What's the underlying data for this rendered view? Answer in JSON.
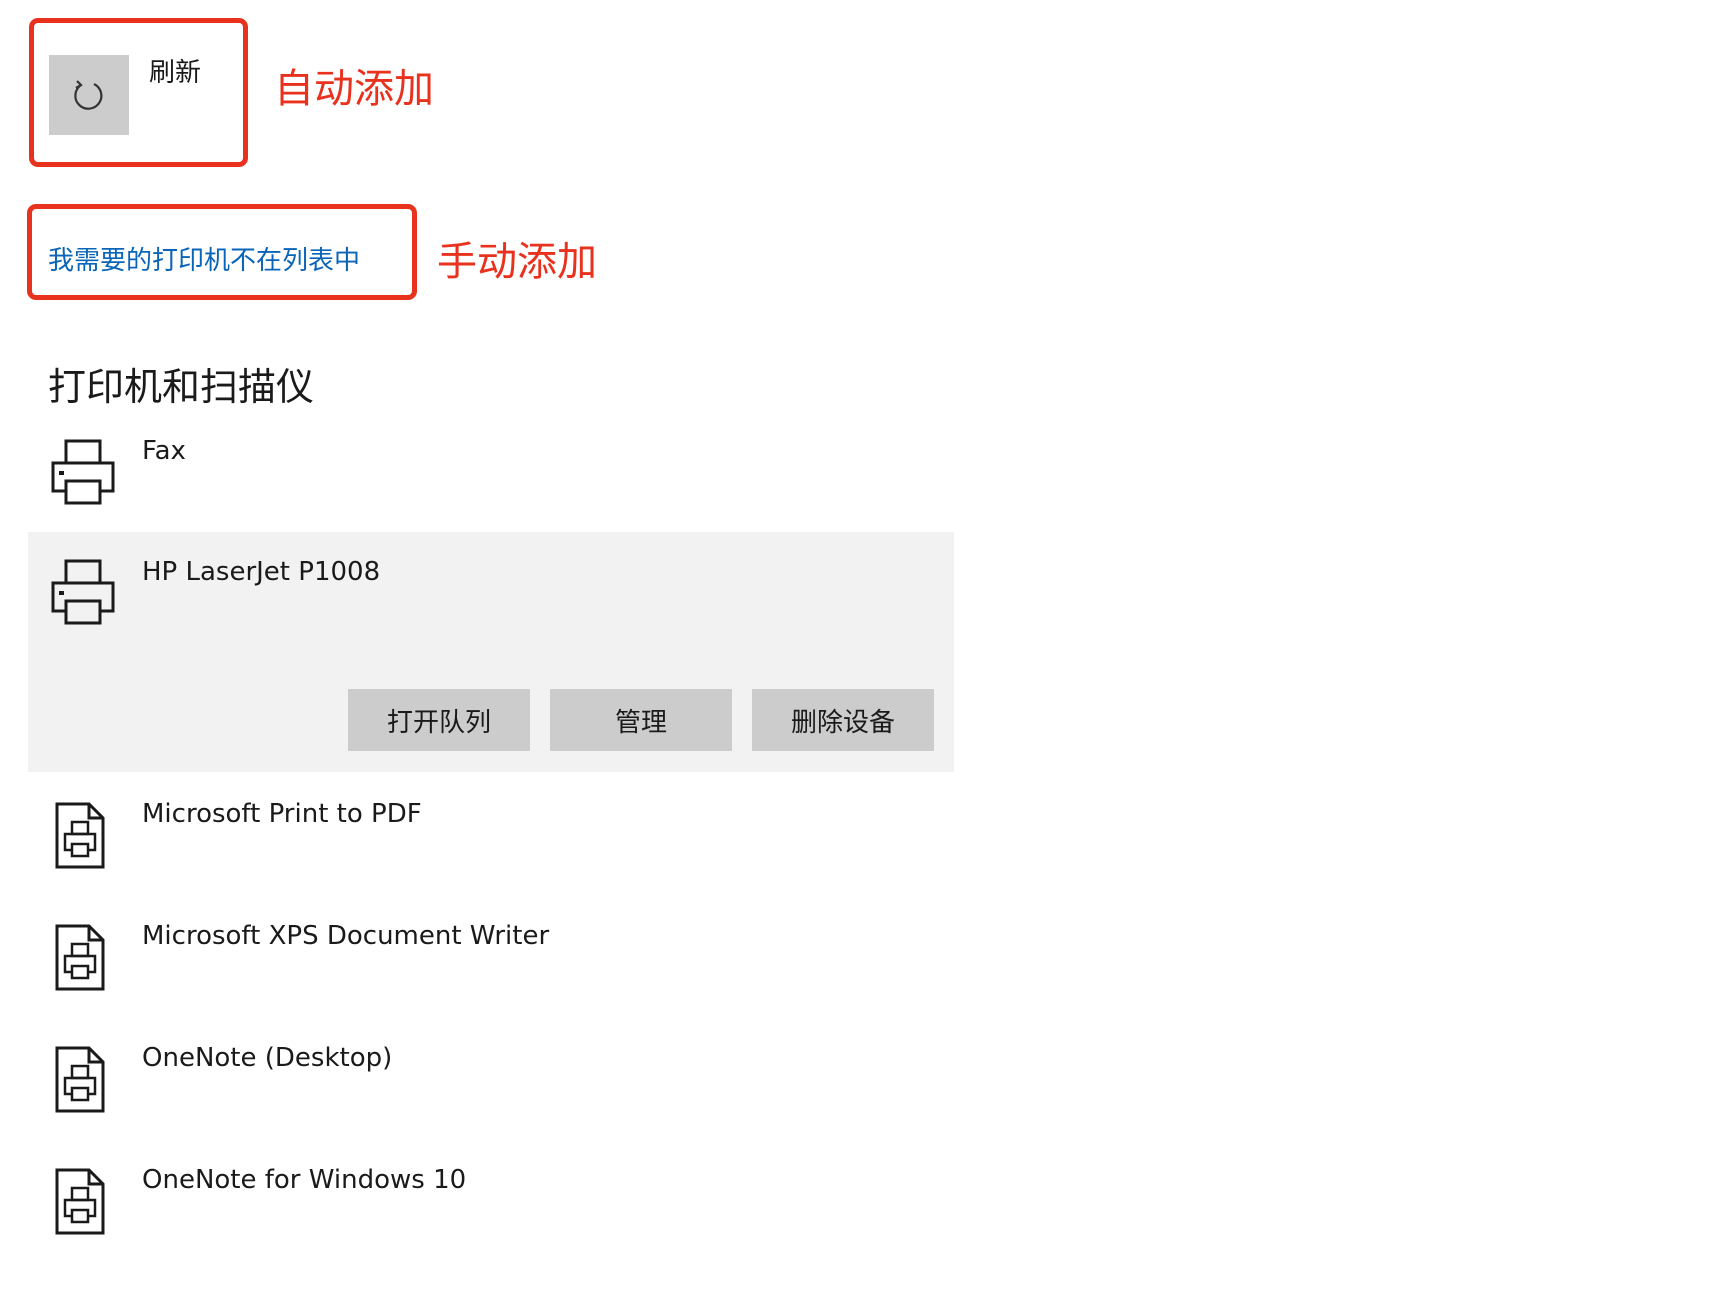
{
  "annotations": {
    "auto_add": "自动添加",
    "manual_add": "手动添加"
  },
  "toolbar": {
    "refresh_icon": "refresh-icon",
    "refresh_label": "刷新"
  },
  "manual_link": "我需要的打印机不在列表中",
  "section_title": "打印机和扫描仪",
  "printers": [
    {
      "name": "Fax",
      "icon": "printer-icon"
    },
    {
      "name": "HP LaserJet P1008",
      "icon": "printer-icon",
      "selected": true,
      "actions": [
        "打开队列",
        "管理",
        "删除设备"
      ]
    },
    {
      "name": "Microsoft Print to PDF",
      "icon": "document-printer-icon"
    },
    {
      "name": "Microsoft XPS Document Writer",
      "icon": "document-printer-icon"
    },
    {
      "name": "OneNote (Desktop)",
      "icon": "document-printer-icon"
    },
    {
      "name": "OneNote for Windows 10",
      "icon": "document-printer-icon"
    }
  ],
  "colors": {
    "annotation": "#e8321e",
    "link": "#0a64b8",
    "selected_bg": "#f2f2f2",
    "button_bg": "#cccccc"
  }
}
